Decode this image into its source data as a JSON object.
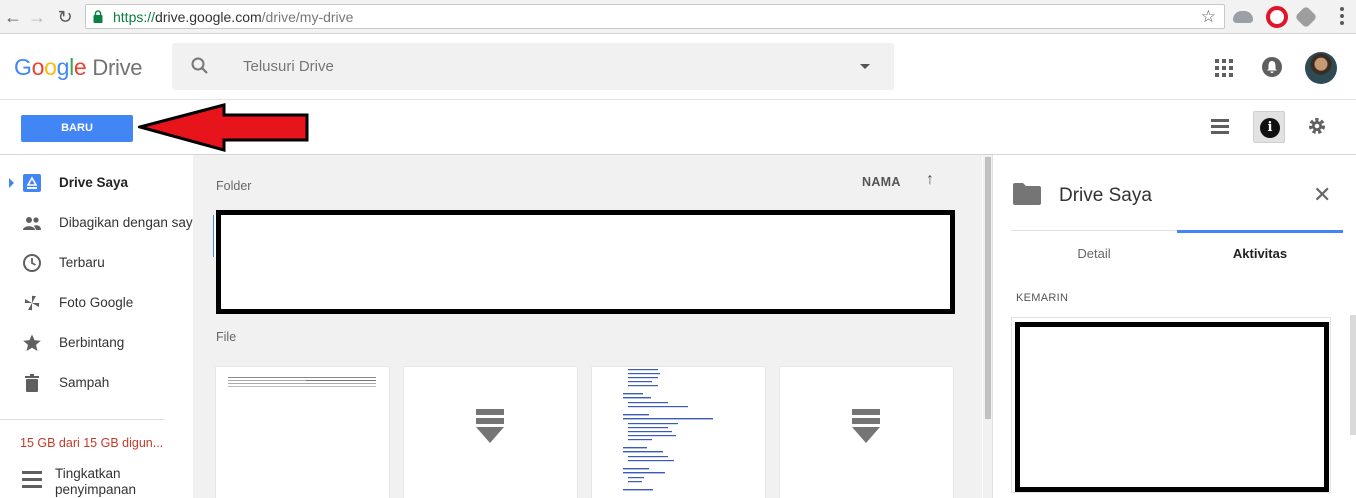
{
  "browser": {
    "url_scheme": "https://",
    "url_host": "drive.google.com",
    "url_path": "/drive/my-drive"
  },
  "header": {
    "logo_letters": [
      "G",
      "o",
      "o",
      "g",
      "l",
      "e"
    ],
    "product_name": "Drive",
    "search_placeholder": "Telusuri Drive"
  },
  "toolbar": {
    "new_label": "BARU"
  },
  "sidebar": {
    "items": [
      {
        "label": "Drive Saya",
        "icon": "drive-icon",
        "active": true
      },
      {
        "label": "Dibagikan dengan saya",
        "icon": "people-icon",
        "active": false
      },
      {
        "label": "Terbaru",
        "icon": "clock-icon",
        "active": false
      },
      {
        "label": "Foto Google",
        "icon": "pinwheel-icon",
        "active": false
      },
      {
        "label": "Berbintang",
        "icon": "star-icon",
        "active": false
      },
      {
        "label": "Sampah",
        "icon": "trash-icon",
        "active": false
      }
    ],
    "storage_text": "15 GB dari 15 GB digun...",
    "upgrade_line1": "Tingkatkan",
    "upgrade_line2": "penyimpanan"
  },
  "main": {
    "folder_section_label": "Folder",
    "sort_label": "NAMA",
    "sort_arrow": "↑",
    "file_section_label": "File"
  },
  "panel": {
    "title": "Drive Saya",
    "tabs": [
      {
        "label": "Detail",
        "active": false
      },
      {
        "label": "Aktivitas",
        "active": true
      }
    ],
    "section_label": "KEMARIN"
  },
  "colors": {
    "accent": "#4285f4",
    "storage_warning": "#c53929",
    "annotation_arrow": "#e8141c"
  }
}
